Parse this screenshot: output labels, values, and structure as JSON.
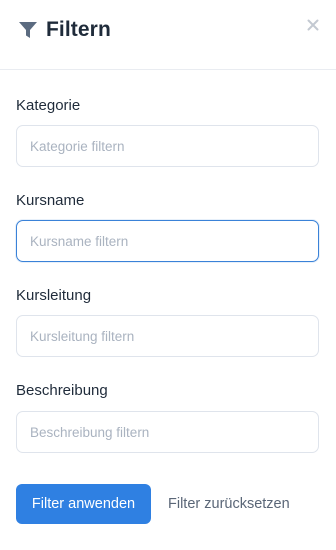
{
  "header": {
    "title": "Filtern",
    "close_icon": "close-icon",
    "filter_icon": "funnel-icon"
  },
  "fields": [
    {
      "label": "Kategorie",
      "placeholder": "Kategorie filtern",
      "value": ""
    },
    {
      "label": "Kursname",
      "placeholder": "Kursname filtern",
      "value": "",
      "focused": true
    },
    {
      "label": "Kursleitung",
      "placeholder": "Kursleitung filtern",
      "value": ""
    },
    {
      "label": "Beschreibung",
      "placeholder": "Beschreibung filtern",
      "value": ""
    }
  ],
  "actions": {
    "apply_label": "Filter anwenden",
    "reset_label": "Filter zurücksetzen"
  },
  "colors": {
    "primary": "#2f80e2",
    "focus_border": "#3a82d8",
    "text": "#1f2b3a",
    "placeholder": "#aab3c0",
    "border": "#dfe4ec"
  }
}
